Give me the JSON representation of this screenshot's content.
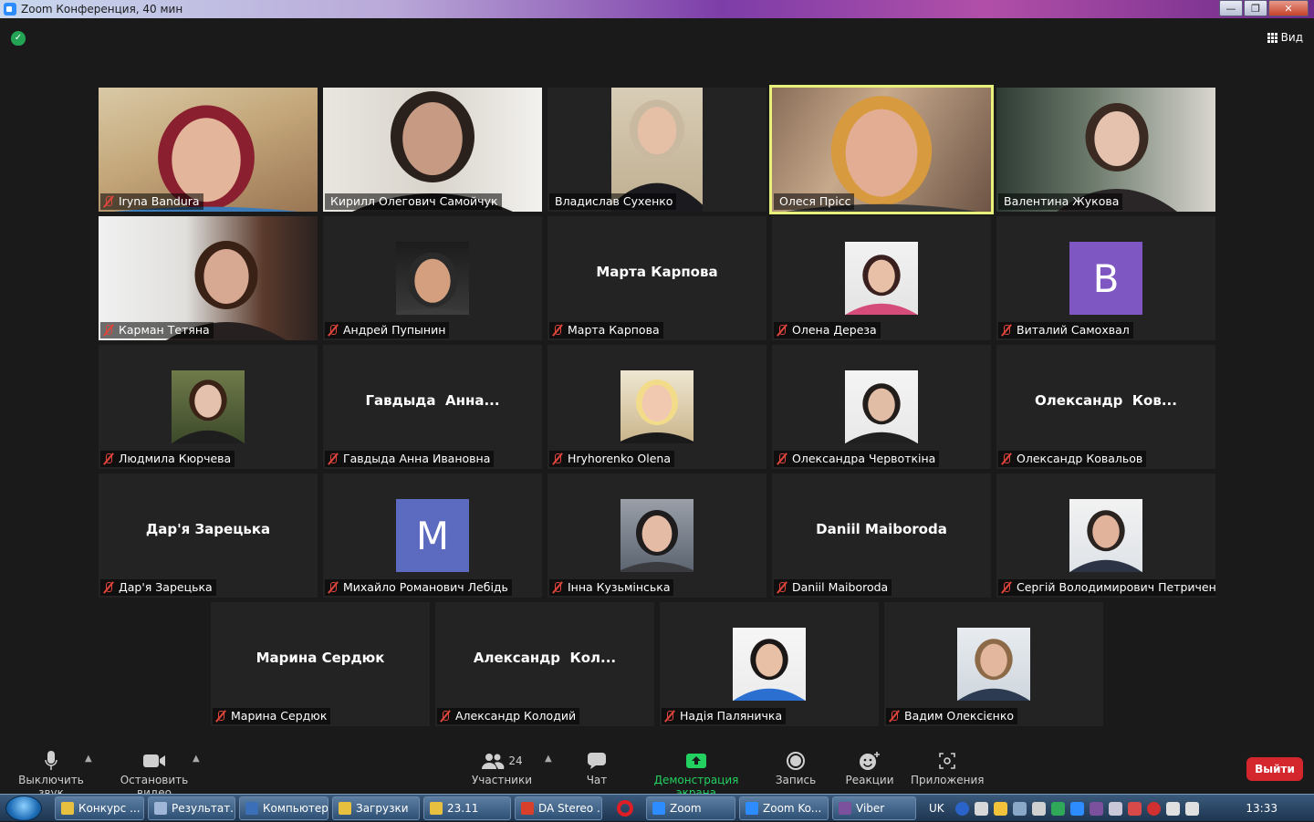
{
  "window": {
    "title": "Zoom Конференция, 40 мин",
    "buttons": {
      "minimize": "—",
      "maximize": "❐",
      "close": "✕"
    }
  },
  "topbar": {
    "view_label": "Вид"
  },
  "participants": [
    {
      "label": "Iryna Bandura",
      "muted": true
    },
    {
      "label": "Кирилл Олегович Самойчук",
      "muted": false
    },
    {
      "label": "Владислав Сухенко",
      "muted": false
    },
    {
      "label": "Олеся Прісс",
      "muted": false
    },
    {
      "label": "Валентина Жукова",
      "muted": false
    },
    {
      "label": "Карман Тетяна",
      "muted": true
    },
    {
      "label": "Андрей Пупынин",
      "muted": true
    },
    {
      "label": "Марта Карпова",
      "muted": true,
      "big": "Марта Карпова"
    },
    {
      "label": "Олена Дереза",
      "muted": true
    },
    {
      "label": "Виталий Самохвал",
      "muted": true,
      "letter": "В"
    },
    {
      "label": "Людмила Кюрчева",
      "muted": true
    },
    {
      "label": "Гавдыда Анна Ивановна",
      "muted": true,
      "big": "Гавдыда  Анна..."
    },
    {
      "label": "Hryhorenko Olena",
      "muted": true
    },
    {
      "label": "Олександра Червоткіна",
      "muted": true
    },
    {
      "label": "Олександр Ковальов",
      "muted": true,
      "big": "Олександр  Ков..."
    },
    {
      "label": "Дар'я Зарецька",
      "muted": true,
      "big": "Дар'я Зарецька"
    },
    {
      "label": "Михайло Романович Лебідь",
      "muted": true,
      "letter": "M"
    },
    {
      "label": "Інна Кузьмінська",
      "muted": true
    },
    {
      "label": "Daniil Maiboroda",
      "muted": true,
      "big": "Daniil Maiboroda"
    },
    {
      "label": "Сергій Володимирович Петриченко",
      "muted": true
    },
    {
      "label": "Марина Сердюк",
      "muted": true,
      "big": "Марина Сердюк"
    },
    {
      "label": "Александр Колодий",
      "muted": true,
      "big": "Александр  Кол..."
    },
    {
      "label": "Надія Паляничка",
      "muted": true
    },
    {
      "label": "Вадим Олексієнко",
      "muted": true
    }
  ],
  "toolbar": {
    "mute_label": "Выключить звук",
    "video_label": "Остановить видео",
    "participants_label": "Участники",
    "participants_count": "24",
    "chat_label": "Чат",
    "share_label": "Демонстрация экрана",
    "record_label": "Запись",
    "reactions_label": "Реакции",
    "apps_label": "Приложения",
    "leave_label": "Выйти"
  },
  "taskbar": {
    "tasks": [
      {
        "label": "Конкурс ...",
        "icon_color": "#e8c040"
      },
      {
        "label": "Результат...",
        "icon_color": "#9fb6d8"
      },
      {
        "label": "Компьютер",
        "icon_color": "#3b6fb8"
      },
      {
        "label": "Загрузки",
        "icon_color": "#e8c040"
      },
      {
        "label": "23.11",
        "icon_color": "#e8c040"
      },
      {
        "label": "DA Stereo ...",
        "icon_color": "#d8402c"
      },
      {
        "label": "Zoom",
        "icon_color": "#2d8cff"
      },
      {
        "label": "Zoom Ko...",
        "icon_color": "#2d8cff"
      },
      {
        "label": "Viber",
        "icon_color": "#7b519d"
      }
    ],
    "lang": "UK",
    "clock": "13:33"
  },
  "colors": {
    "active_speaker": "#e8f27a",
    "avatar_purple": "#7e57c2",
    "avatar_blue": "#5c6bc0",
    "leave_red": "#d4262d",
    "share_green": "#23d160"
  }
}
